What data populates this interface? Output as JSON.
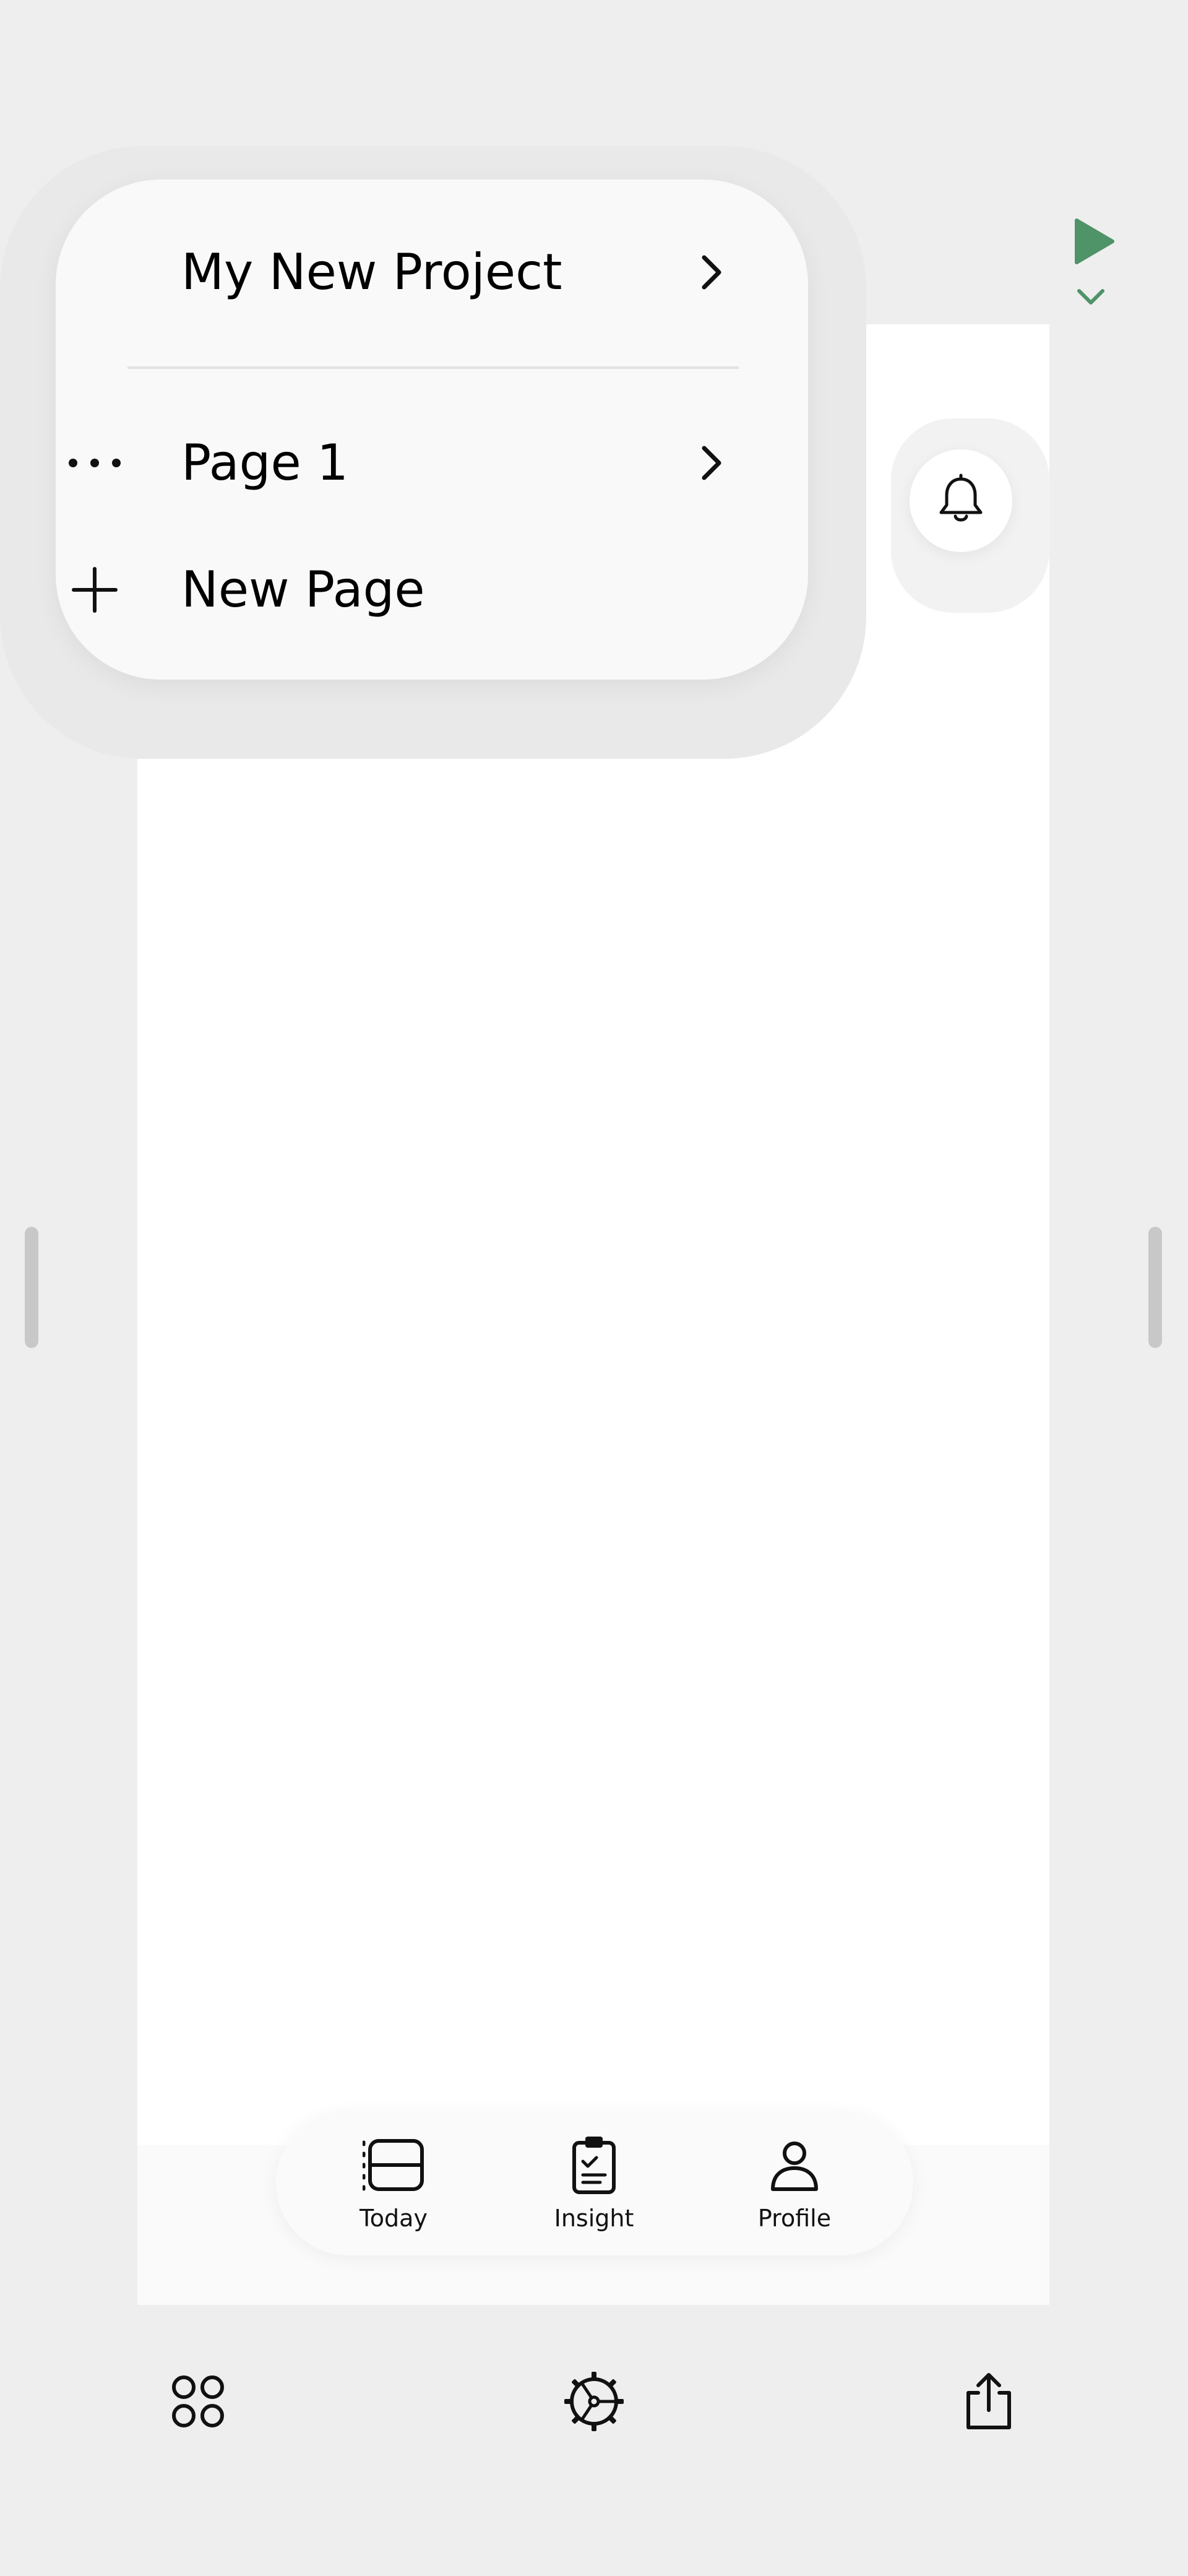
{
  "menu": {
    "project_title": "My New Project",
    "pages": [
      {
        "label": "Page 1"
      }
    ],
    "new_page_label": "New Page"
  },
  "tabbar": {
    "tabs": [
      {
        "label": "Today",
        "icon": "list-icon"
      },
      {
        "label": "Insight",
        "icon": "clipboard-icon"
      },
      {
        "label": "Profile",
        "icon": "person-icon"
      }
    ]
  },
  "toolbar": {
    "icons": [
      "components-icon",
      "settings-gear-icon",
      "share-icon"
    ]
  },
  "colors": {
    "accent": "#4f9368",
    "background": "#eeeeee",
    "canvas": "#ffffff",
    "menu": "#f9f9f9"
  }
}
